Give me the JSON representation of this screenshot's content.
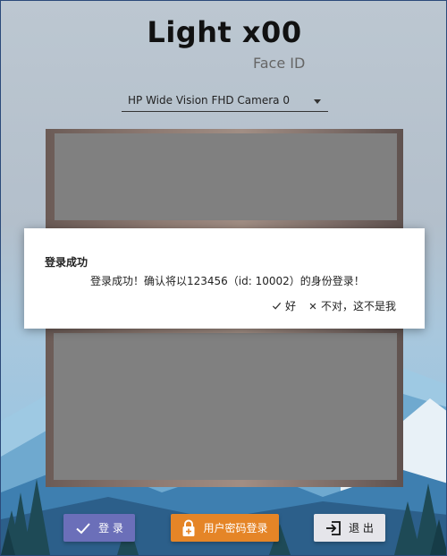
{
  "app": {
    "title": "Light x00",
    "subtitle": "Face ID"
  },
  "camera": {
    "selected": "HP Wide Vision FHD Camera 0"
  },
  "dialog": {
    "title": "登录成功",
    "message": "登录成功！确认将以123456（id: 10002）的身份登录！",
    "ok_label": "好",
    "ok_icon": "check-icon",
    "cancel_label": "不对，这不是我",
    "cancel_icon": "close-icon"
  },
  "buttons": {
    "login_label": "登 录",
    "login_icon": "check-icon",
    "login_color": "#6b6fb9",
    "password_label": "用户密码登录",
    "password_icon": "lock-icon",
    "password_color": "#e58527",
    "exit_label": "退 出",
    "exit_icon": "exit-icon",
    "exit_color": "#e5e5ea"
  }
}
